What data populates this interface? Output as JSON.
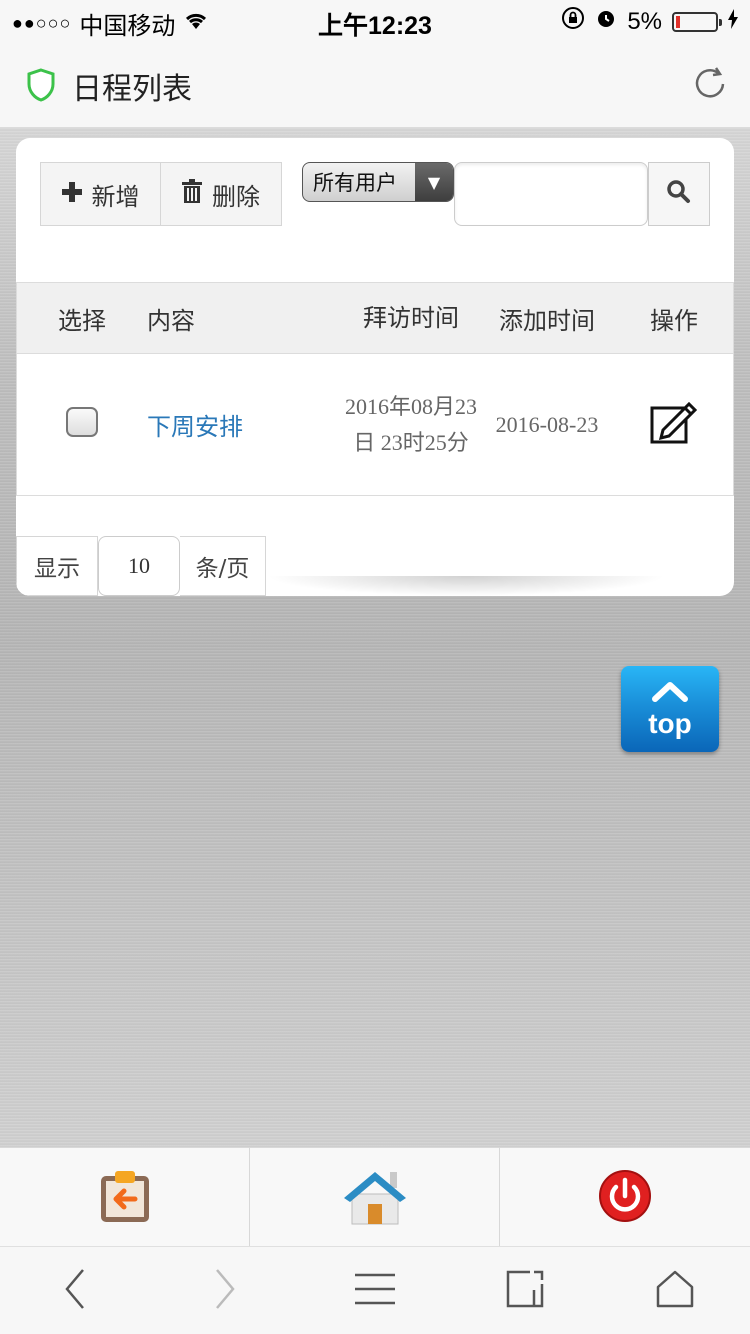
{
  "status_bar": {
    "carrier": "中国移动",
    "time": "上午12:23",
    "battery": "5%"
  },
  "title_bar": {
    "title": "日程列表"
  },
  "toolbar_buttons": {
    "add_label": "新增",
    "delete_label": "删除"
  },
  "filter": {
    "selected_user": "所有用户",
    "search_value": ""
  },
  "table": {
    "headers": [
      "选择",
      "内容",
      "拜访时间",
      "添加时间",
      "操作"
    ],
    "rows": [
      {
        "content": "下周安排",
        "visit_time": "2016年08月23日 23时25分",
        "added_time": "2016-08-23"
      }
    ]
  },
  "pager": {
    "show_label": "显示",
    "page_size": "10",
    "unit_label": "条/页"
  },
  "top_button": {
    "label": "top"
  },
  "colors": {
    "link": "#2a78b8",
    "top_button": "#1a8fd9",
    "power_button": "#e02020",
    "shield": "#3cc24a"
  }
}
